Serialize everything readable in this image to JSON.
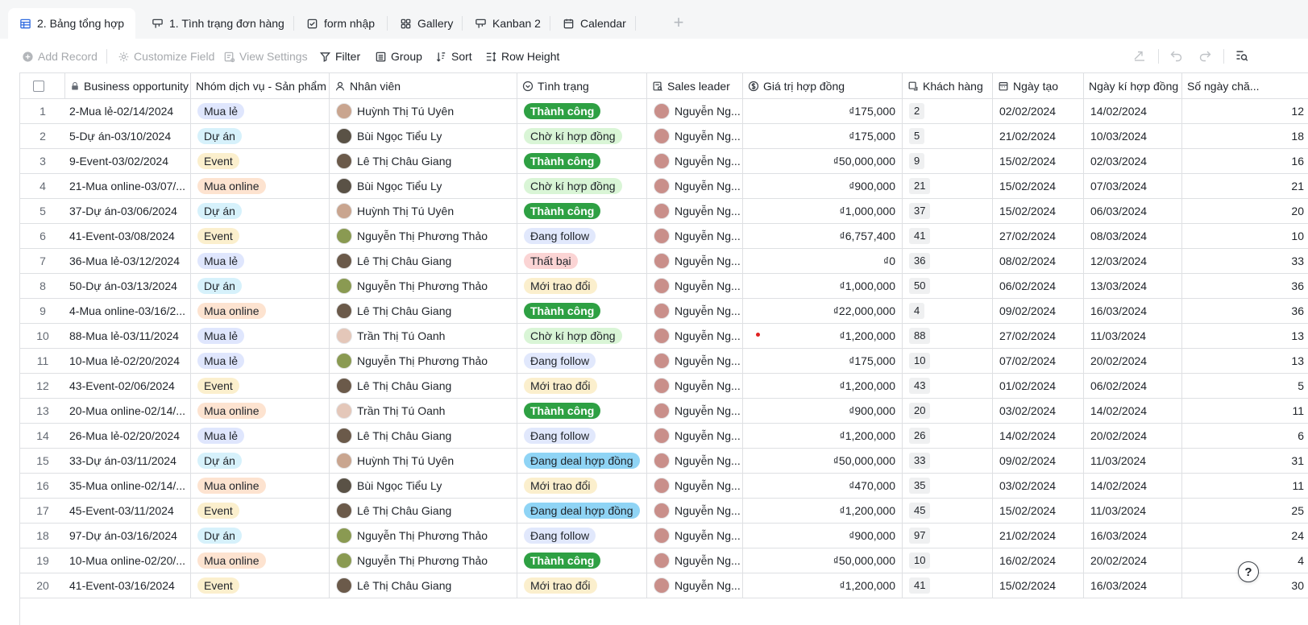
{
  "tabs": [
    {
      "label": "2. Bảng tổng hợp",
      "icon": "grid-table-icon",
      "active": true
    },
    {
      "label": "1. Tình trạng đơn hàng",
      "icon": "kanban-icon",
      "active": false
    },
    {
      "label": "form nhập",
      "icon": "form-check-icon",
      "active": false
    },
    {
      "label": "Gallery",
      "icon": "gallery-icon",
      "active": false
    },
    {
      "label": "Kanban 2",
      "icon": "kanban-icon",
      "active": false
    },
    {
      "label": "Calendar",
      "icon": "calendar-icon",
      "active": false
    }
  ],
  "toolbar": {
    "add_record": "Add Record",
    "customize_field": "Customize Field",
    "view_settings": "View Settings",
    "filter": "Filter",
    "group": "Group",
    "sort": "Sort",
    "row_height": "Row Height"
  },
  "columns": [
    {
      "key": "opportunity",
      "label": "Business opportunity",
      "icon": "lock-icon"
    },
    {
      "key": "service",
      "label": "Nhóm dịch vụ - Sản phẩm",
      "icon": ""
    },
    {
      "key": "employee",
      "label": "Nhân viên",
      "icon": "person-icon"
    },
    {
      "key": "status",
      "label": "Tình trạng",
      "icon": "chevron-circle-icon"
    },
    {
      "key": "leader",
      "label": "Sales leader",
      "icon": "lookup-icon"
    },
    {
      "key": "value",
      "label": "Giá trị hợp đồng",
      "icon": "currency-icon"
    },
    {
      "key": "customer",
      "label": "Khách hàng",
      "icon": "link-icon"
    },
    {
      "key": "created",
      "label": "Ngày tạo",
      "icon": "date-icon"
    },
    {
      "key": "signed",
      "label": "Ngày kí hợp đồng",
      "icon": ""
    },
    {
      "key": "days",
      "label": "Số ngày chă...",
      "icon": ""
    }
  ],
  "colors": {
    "tag_mua_le": "#dfe6fd",
    "tag_du_an": "#d6f1fb",
    "tag_event": "#fbefcd",
    "tag_mua_online": "#fde3d0",
    "status_thanh_cong": "#2ea043",
    "status_cho_ki": "#d9f5d6",
    "status_dang_follow": "#e1e8fc",
    "status_that_bai": "#fbd4d4",
    "status_moi_trao_doi": "#fbefcd",
    "status_dang_deal": "#8fd4f5"
  },
  "rows": [
    {
      "n": "1",
      "opportunity": "2-Mua lẻ-02/14/2024",
      "service": "Mua lẻ",
      "employee": "Huỳnh Thị Tú Uyên",
      "status": "Thành công",
      "leader": "Nguyễn Ng...",
      "value": "₫175,000",
      "customer": "2",
      "created": "02/02/2024",
      "signed": "14/02/2024",
      "days": "12"
    },
    {
      "n": "2",
      "opportunity": "5-Dự án-03/10/2024",
      "service": "Dự án",
      "employee": "Bùi Ngọc Tiểu Ly",
      "status": "Chờ kí hợp đồng",
      "leader": "Nguyễn Ng...",
      "value": "₫175,000",
      "customer": "5",
      "created": "21/02/2024",
      "signed": "10/03/2024",
      "days": "18"
    },
    {
      "n": "3",
      "opportunity": "9-Event-03/02/2024",
      "service": "Event",
      "employee": "Lê Thị Châu Giang",
      "status": "Thành công",
      "leader": "Nguyễn Ng...",
      "value": "₫50,000,000",
      "customer": "9",
      "created": "15/02/2024",
      "signed": "02/03/2024",
      "days": "16"
    },
    {
      "n": "4",
      "opportunity": "21-Mua online-03/07/...",
      "service": "Mua online",
      "employee": "Bùi Ngọc Tiểu Ly",
      "status": "Chờ kí hợp đồng",
      "leader": "Nguyễn Ng...",
      "value": "₫900,000",
      "customer": "21",
      "created": "15/02/2024",
      "signed": "07/03/2024",
      "days": "21"
    },
    {
      "n": "5",
      "opportunity": "37-Dự án-03/06/2024",
      "service": "Dự án",
      "employee": "Huỳnh Thị Tú Uyên",
      "status": "Thành công",
      "leader": "Nguyễn Ng...",
      "value": "₫1,000,000",
      "customer": "37",
      "created": "15/02/2024",
      "signed": "06/03/2024",
      "days": "20"
    },
    {
      "n": "6",
      "opportunity": "41-Event-03/08/2024",
      "service": "Event",
      "employee": "Nguyễn Thị Phương Thảo",
      "status": "Đang follow",
      "leader": "Nguyễn Ng...",
      "value": "₫6,757,400",
      "customer": "41",
      "created": "27/02/2024",
      "signed": "08/03/2024",
      "days": "10"
    },
    {
      "n": "7",
      "opportunity": "36-Mua lẻ-03/12/2024",
      "service": "Mua lẻ",
      "employee": "Lê Thị Châu Giang",
      "status": "Thất bại",
      "leader": "Nguyễn Ng...",
      "value": "₫0",
      "customer": "36",
      "created": "08/02/2024",
      "signed": "12/03/2024",
      "days": "33"
    },
    {
      "n": "8",
      "opportunity": "50-Dự án-03/13/2024",
      "service": "Dự án",
      "employee": "Nguyễn Thị Phương Thảo",
      "status": "Mới trao đổi",
      "leader": "Nguyễn Ng...",
      "value": "₫1,000,000",
      "customer": "50",
      "created": "06/02/2024",
      "signed": "13/03/2024",
      "days": "36"
    },
    {
      "n": "9",
      "opportunity": "4-Mua online-03/16/2...",
      "service": "Mua online",
      "employee": "Lê Thị Châu Giang",
      "status": "Thành công",
      "leader": "Nguyễn Ng...",
      "value": "₫22,000,000",
      "customer": "4",
      "created": "09/02/2024",
      "signed": "16/03/2024",
      "days": "36"
    },
    {
      "n": "10",
      "opportunity": "88-Mua lẻ-03/11/2024",
      "service": "Mua lẻ",
      "employee": "Trần Thị Tú Oanh",
      "status": "Chờ kí hợp đồng",
      "leader": "Nguyễn Ng...",
      "value": "₫1,200,000",
      "customer": "88",
      "created": "27/02/2024",
      "signed": "11/03/2024",
      "days": "13"
    },
    {
      "n": "11",
      "opportunity": "10-Mua lẻ-02/20/2024",
      "service": "Mua lẻ",
      "employee": "Nguyễn Thị Phương Thảo",
      "status": "Đang follow",
      "leader": "Nguyễn Ng...",
      "value": "₫175,000",
      "customer": "10",
      "created": "07/02/2024",
      "signed": "20/02/2024",
      "days": "13"
    },
    {
      "n": "12",
      "opportunity": "43-Event-02/06/2024",
      "service": "Event",
      "employee": "Lê Thị Châu Giang",
      "status": "Mới trao đổi",
      "leader": "Nguyễn Ng...",
      "value": "₫1,200,000",
      "customer": "43",
      "created": "01/02/2024",
      "signed": "06/02/2024",
      "days": "5"
    },
    {
      "n": "13",
      "opportunity": "20-Mua online-02/14/...",
      "service": "Mua online",
      "employee": "Trần Thị Tú Oanh",
      "status": "Thành công",
      "leader": "Nguyễn Ng...",
      "value": "₫900,000",
      "customer": "20",
      "created": "03/02/2024",
      "signed": "14/02/2024",
      "days": "11"
    },
    {
      "n": "14",
      "opportunity": "26-Mua lẻ-02/20/2024",
      "service": "Mua lẻ",
      "employee": "Lê Thị Châu Giang",
      "status": "Đang follow",
      "leader": "Nguyễn Ng...",
      "value": "₫1,200,000",
      "customer": "26",
      "created": "14/02/2024",
      "signed": "20/02/2024",
      "days": "6"
    },
    {
      "n": "15",
      "opportunity": "33-Dự án-03/11/2024",
      "service": "Dự án",
      "employee": "Huỳnh Thị Tú Uyên",
      "status": "Đang deal hợp đồng",
      "leader": "Nguyễn Ng...",
      "value": "₫50,000,000",
      "customer": "33",
      "created": "09/02/2024",
      "signed": "11/03/2024",
      "days": "31"
    },
    {
      "n": "16",
      "opportunity": "35-Mua online-02/14/...",
      "service": "Mua online",
      "employee": "Bùi Ngọc Tiểu Ly",
      "status": "Mới trao đổi",
      "leader": "Nguyễn Ng...",
      "value": "₫470,000",
      "customer": "35",
      "created": "03/02/2024",
      "signed": "14/02/2024",
      "days": "11"
    },
    {
      "n": "17",
      "opportunity": "45-Event-03/11/2024",
      "service": "Event",
      "employee": "Lê Thị Châu Giang",
      "status": "Đang deal hợp đồng",
      "leader": "Nguyễn Ng...",
      "value": "₫1,200,000",
      "customer": "45",
      "created": "15/02/2024",
      "signed": "11/03/2024",
      "days": "25"
    },
    {
      "n": "18",
      "opportunity": "97-Dự án-03/16/2024",
      "service": "Dự án",
      "employee": "Nguyễn Thị Phương Thảo",
      "status": "Đang follow",
      "leader": "Nguyễn Ng...",
      "value": "₫900,000",
      "customer": "97",
      "created": "21/02/2024",
      "signed": "16/03/2024",
      "days": "24"
    },
    {
      "n": "19",
      "opportunity": "10-Mua online-02/20/...",
      "service": "Mua online",
      "employee": "Nguyễn Thị Phương Thảo",
      "status": "Thành công",
      "leader": "Nguyễn Ng...",
      "value": "₫50,000,000",
      "customer": "10",
      "created": "16/02/2024",
      "signed": "20/02/2024",
      "days": "4"
    },
    {
      "n": "20",
      "opportunity": "41-Event-03/16/2024",
      "service": "Event",
      "employee": "Lê Thị Châu Giang",
      "status": "Mới trao đổi",
      "leader": "Nguyễn Ng...",
      "value": "₫1,200,000",
      "customer": "41",
      "created": "15/02/2024",
      "signed": "16/03/2024",
      "days": "30"
    }
  ],
  "help": "?"
}
